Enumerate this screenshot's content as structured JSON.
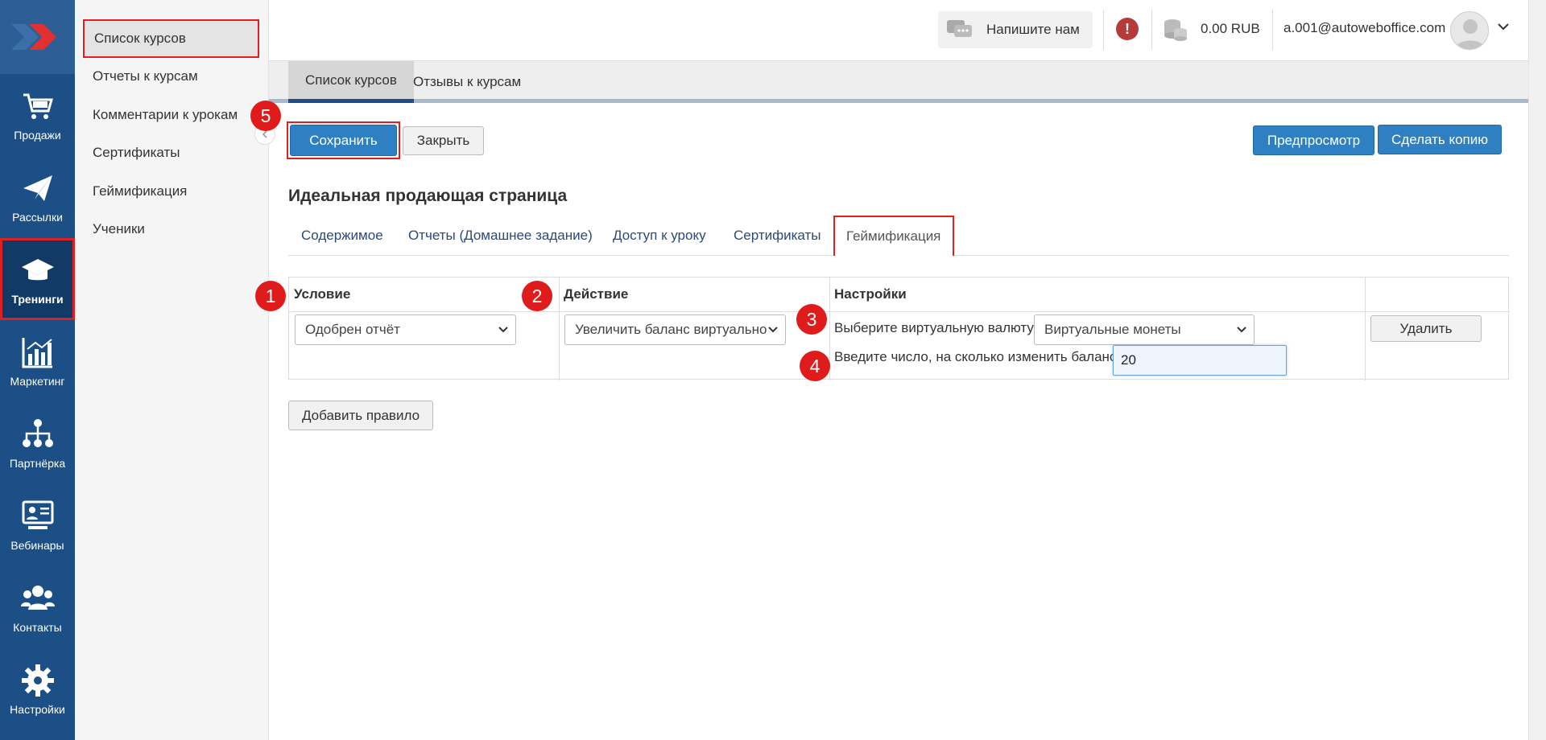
{
  "rail": {
    "items": [
      {
        "label": "Продажи",
        "icon": "cart-icon"
      },
      {
        "label": "Рассылки",
        "icon": "paper-plane-icon"
      },
      {
        "label": "Тренинги",
        "icon": "graduation-cap-icon"
      },
      {
        "label": "Маркетинг",
        "icon": "chart-icon"
      },
      {
        "label": "Партнёрка",
        "icon": "network-icon"
      },
      {
        "label": "Вебинары",
        "icon": "webinar-icon"
      },
      {
        "label": "Контакты",
        "icon": "users-icon"
      },
      {
        "label": "Настройки",
        "icon": "gear-icon"
      }
    ],
    "active": "Тренинги"
  },
  "submenu": {
    "items": [
      "Список курсов",
      "Отчеты к курсам",
      "Комментарии к урокам",
      "Сертификаты",
      "Геймификация",
      "Ученики"
    ],
    "active": "Список курсов"
  },
  "topbar": {
    "write_us": "Напишите нам",
    "balance": "0.00 RUB",
    "email": "a.001@autoweboffice.com",
    "alert_symbol": "!"
  },
  "top_tabs": [
    "Список курсов",
    "Отзывы к курсам"
  ],
  "toolbar": {
    "save": "Сохранить",
    "close": "Закрыть",
    "preview": "Предпросмотр",
    "copy": "Сделать копию"
  },
  "page_title": "Идеальная продающая страница",
  "inner_tabs": [
    "Содержимое",
    "Отчеты (Домашнее задание)",
    "Доступ к уроку",
    "Сертификаты",
    "Геймификация"
  ],
  "rules_table": {
    "headers": [
      "Условие",
      "Действие",
      "Настройки",
      ""
    ],
    "row": {
      "condition": "Одобрен отчёт",
      "action": "Увеличить баланс виртуально",
      "currency_label": "Выберите виртуальную валюту",
      "currency_value": "Виртуальные монеты",
      "amount_label": "Введите число, на сколько изменить баланс",
      "amount_value": "20",
      "delete": "Удалить"
    }
  },
  "add_rule": "Добавить правило",
  "step_badges": [
    "1",
    "2",
    "3",
    "4",
    "5"
  ],
  "colors": {
    "rail": "#1b4f86",
    "primary": "#2e80c2",
    "highlight": "#e02020",
    "badge": "#e01b1b"
  }
}
